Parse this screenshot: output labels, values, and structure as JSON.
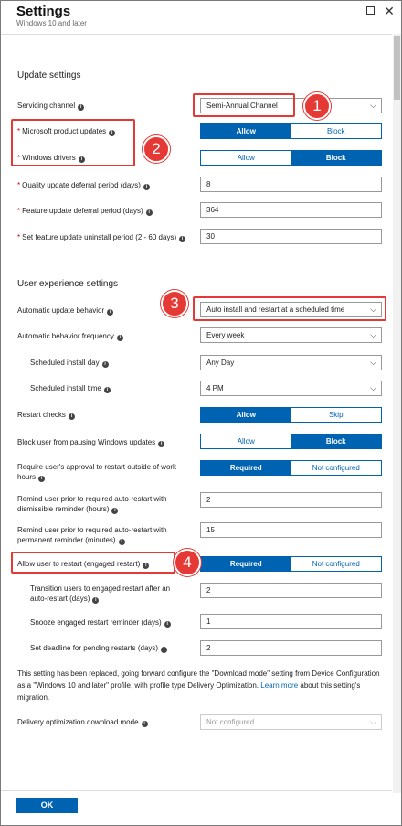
{
  "header": {
    "title": "Settings",
    "subtitle": "Windows 10 and later",
    "maximize_icon": "maximize-icon",
    "close_icon": "close-icon",
    "close_glyph": "✕"
  },
  "sections": {
    "update_settings": "Update settings",
    "user_experience": "User experience settings"
  },
  "fields": {
    "servicing_channel": {
      "label": "Servicing channel",
      "value": "Semi-Annual Channel"
    },
    "microsoft_product_updates": {
      "label": "Microsoft product updates",
      "options": [
        "Allow",
        "Block"
      ],
      "selected": "Allow"
    },
    "windows_drivers": {
      "label": "Windows drivers",
      "options": [
        "Allow",
        "Block"
      ],
      "selected": "Block"
    },
    "quality_deferral": {
      "label": "Quality update deferral period (days)",
      "value": "8"
    },
    "feature_deferral": {
      "label": "Feature update deferral period (days)",
      "value": "364"
    },
    "feature_uninstall": {
      "label": "Set feature update uninstall period (2 - 60 days)",
      "value": "30"
    },
    "auto_update_behavior": {
      "label": "Automatic update behavior",
      "value": "Auto install and restart at a scheduled time"
    },
    "auto_behavior_frequency": {
      "label": "Automatic behavior frequency",
      "value": "Every week"
    },
    "scheduled_install_day": {
      "label": "Scheduled install day",
      "value": "Any Day"
    },
    "scheduled_install_time": {
      "label": "Scheduled install time",
      "value": "4 PM"
    },
    "restart_checks": {
      "label": "Restart checks",
      "options": [
        "Allow",
        "Skip"
      ],
      "selected": "Allow"
    },
    "block_pausing": {
      "label": "Block user from pausing Windows updates",
      "options": [
        "Allow",
        "Block"
      ],
      "selected": "Block"
    },
    "require_approval": {
      "label": "Require user's approval to restart outside of work hours",
      "options": [
        "Required",
        "Not configured"
      ],
      "selected": "Required"
    },
    "remind_dismissible": {
      "label": "Remind user prior to required auto-restart with dismissible reminder (hours)",
      "value": "2"
    },
    "remind_permanent": {
      "label": "Remind user prior to required auto-restart with permanent reminder (minutes)",
      "value": "15"
    },
    "allow_engaged_restart": {
      "label": "Allow user to restart (engaged restart)",
      "options": [
        "Required",
        "Not configured"
      ],
      "selected": "Required"
    },
    "transition_engaged": {
      "label": "Transition users to engaged restart after an auto-restart (days)",
      "value": "2"
    },
    "snooze_engaged": {
      "label": "Snooze engaged restart reminder (days)",
      "value": "1"
    },
    "deadline_pending": {
      "label": "Set deadline for pending restarts (days)",
      "value": "2"
    },
    "delivery_optimization": {
      "label": "Delivery optimization download mode",
      "value": "Not configured"
    }
  },
  "notice": {
    "text": "This setting has been replaced, going forward configure the \"Download mode\" setting from Device Configuration as a \"Windows 10 and later\" profile, with profile type Delivery Optimization. ",
    "link": "Learn more",
    "text_after": " about this setting's migration."
  },
  "footer": {
    "ok_label": "OK"
  },
  "annotations": {
    "n1": "1",
    "n2": "2",
    "n3": "3",
    "n4": "4",
    "color": "#e53935"
  },
  "glyphs": {
    "info": "i",
    "required": "*",
    "chevron": "⌵"
  },
  "colors": {
    "accent": "#0063b1",
    "annotation": "#e53935"
  }
}
